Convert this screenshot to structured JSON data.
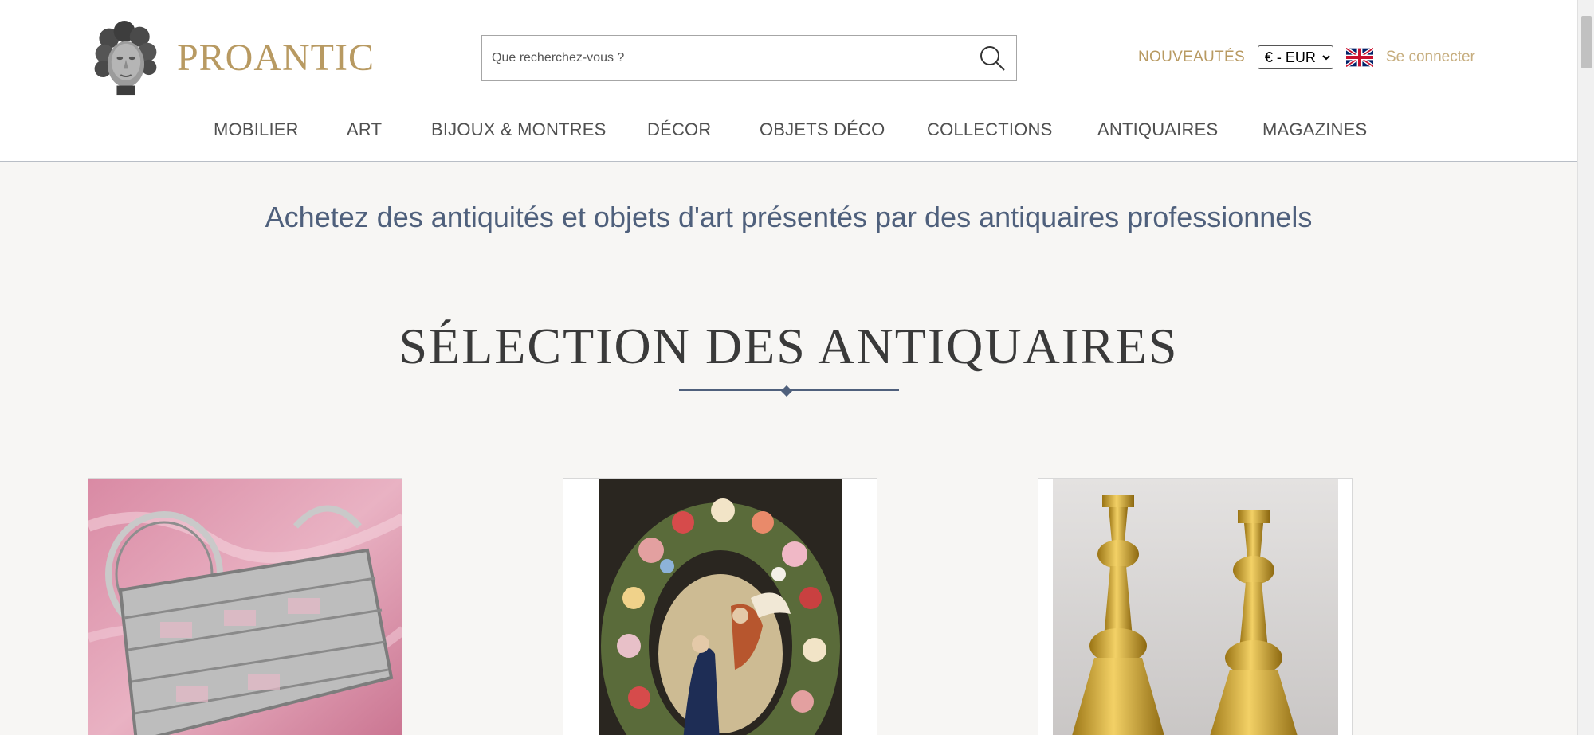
{
  "header": {
    "logo_text": "PROANTIC",
    "search": {
      "placeholder": "Que recherchez-vous ?",
      "value": ""
    },
    "nouveautes_label": "NOUVEAUTÉS",
    "currency": {
      "selected": "€ - EUR"
    },
    "language_flag": "uk-flag-icon",
    "login_label": "Se connecter"
  },
  "nav": {
    "items": [
      {
        "label": "MOBILIER"
      },
      {
        "label": "ART"
      },
      {
        "label": "BIJOUX & MONTRES"
      },
      {
        "label": "DÉCOR"
      },
      {
        "label": "OBJETS DÉCO"
      },
      {
        "label": "COLLECTIONS"
      },
      {
        "label": "ANTIQUAIRES"
      },
      {
        "label": "MAGAZINES"
      }
    ]
  },
  "main": {
    "tagline": "Achetez des antiquités et objets d'art présentés par des antiquaires professionnels",
    "section_title": "SÉLECTION DES ANTIQUAIRES"
  },
  "colors": {
    "brand_gold": "#b89a62",
    "accent_blue": "#4f607c",
    "page_background": "#f7f6f4"
  }
}
